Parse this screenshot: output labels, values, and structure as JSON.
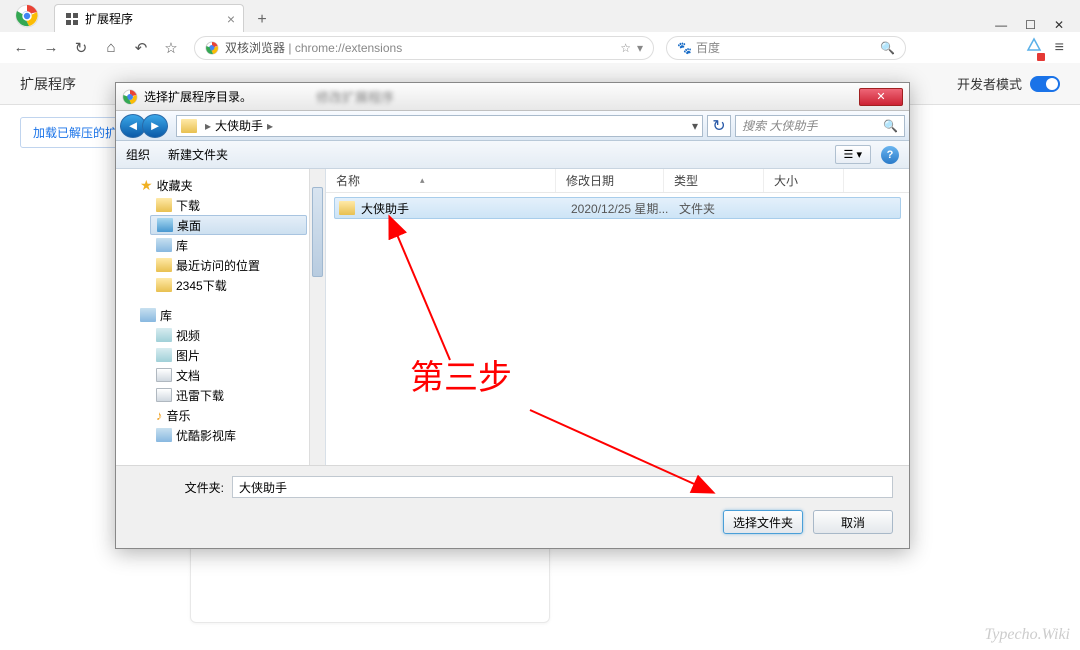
{
  "browser": {
    "tab_title": "扩展程序",
    "url_prefix": "双核浏览器",
    "url": "chrome://extensions",
    "search_engine": "百度"
  },
  "page": {
    "header": "扩展程序",
    "dev_mode": "开发者模式",
    "load_unpacked": "加载已解压的扩"
  },
  "dialog": {
    "title": "选择扩展程序目录。",
    "blurred": "修改扩展程序",
    "breadcrumb_item": "大侠助手",
    "search_placeholder": "搜索 大侠助手",
    "toolbar": {
      "organize": "组织",
      "new_folder": "新建文件夹"
    },
    "tree": {
      "favorites": "收藏夹",
      "downloads": "下载",
      "desktop": "桌面",
      "library": "库",
      "recent": "最近访问的位置",
      "dl2345": "2345下载",
      "lib_header": "库",
      "video": "视频",
      "pictures": "图片",
      "documents": "文档",
      "xunlei": "迅雷下载",
      "music": "音乐",
      "youku": "优酷影视库"
    },
    "columns": {
      "name": "名称",
      "date": "修改日期",
      "type": "类型",
      "size": "大小"
    },
    "file": {
      "name": "大侠助手",
      "date": "2020/12/25 星期...",
      "type": "文件夹"
    },
    "folder_label": "文件夹:",
    "folder_value": "大侠助手",
    "select_btn": "选择文件夹",
    "cancel_btn": "取消"
  },
  "annotation": {
    "step": "第三步"
  },
  "watermark": "Typecho.Wiki"
}
